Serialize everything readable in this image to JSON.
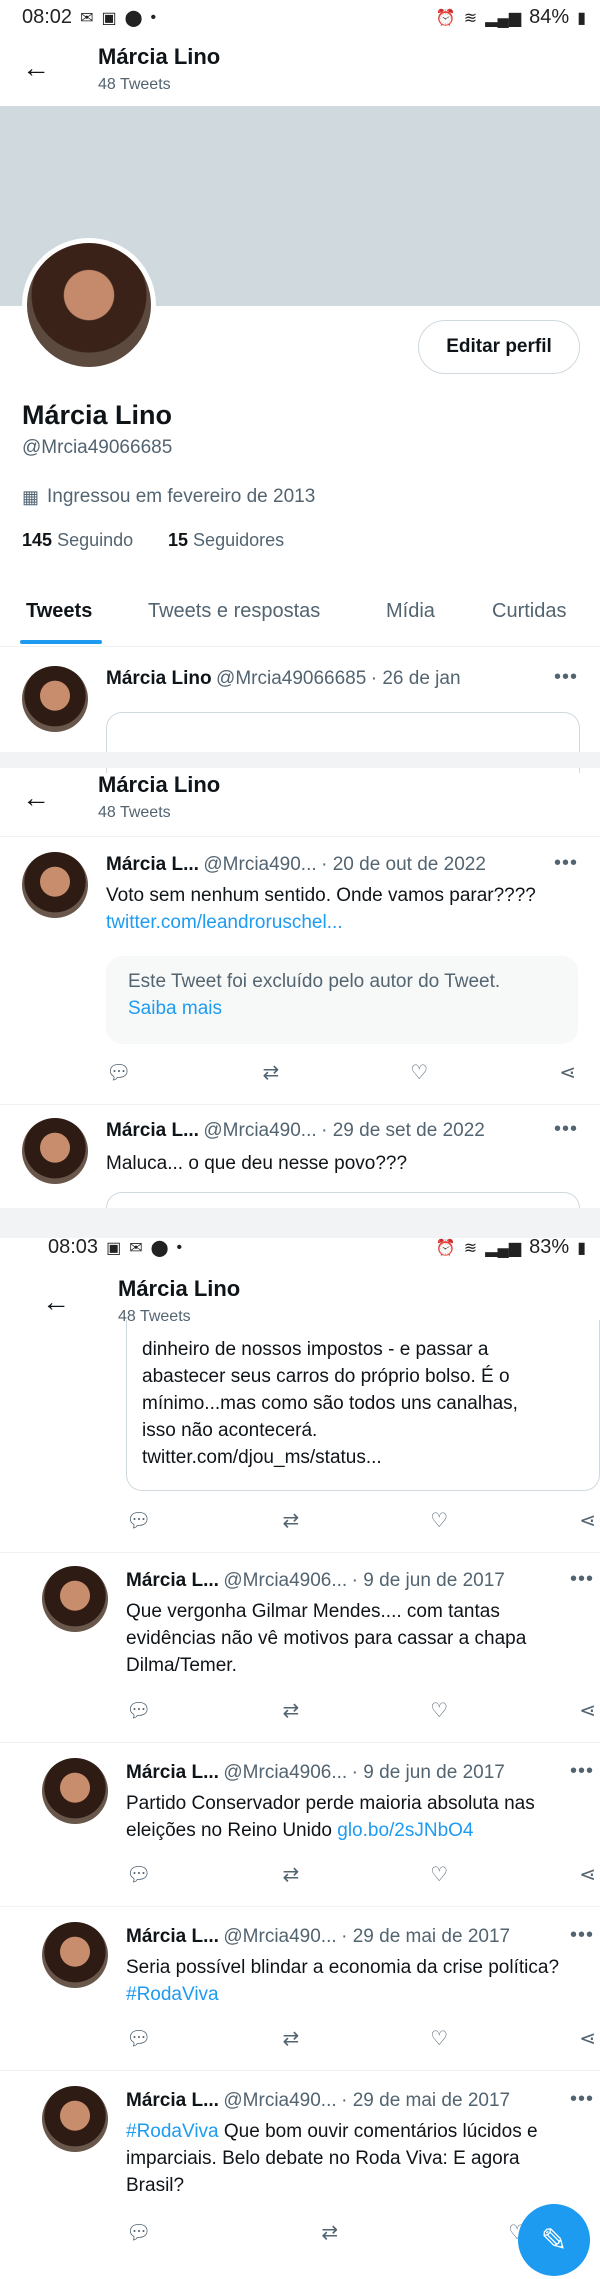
{
  "screens": [
    {
      "time": "08:02",
      "battery": "84%"
    },
    {
      "time": "08:03",
      "battery": "83%"
    }
  ],
  "header": {
    "title": "Márcia Lino",
    "subtitle": "48 Tweets"
  },
  "profile": {
    "name": "Márcia Lino",
    "handle": "@Mrcia49066685",
    "joined": "Ingressou em fevereiro de 2013",
    "following_count": "145",
    "following_label": "Seguindo",
    "followers_count": "15",
    "followers_label": "Seguidores",
    "edit_label": "Editar perfil"
  },
  "tabs": [
    "Tweets",
    "Tweets e respostas",
    "Mídia",
    "Curtidas"
  ],
  "tweets": [
    {
      "name": "Márcia Lino",
      "handle": "@Mrcia49066685",
      "date": "· 26 de jan",
      "text": ""
    },
    {
      "name": "Márcia L...",
      "handle": "@Mrcia490...",
      "date": "· 20 de out de 2022",
      "text": "Voto sem nenhum sentido. Onde vamos parar????",
      "link": "twitter.com/leandroruschel...",
      "deleted_text": "Este Tweet foi excluído pelo autor do Tweet.",
      "deleted_link": "Saiba mais"
    },
    {
      "name": "Márcia L...",
      "handle": "@Mrcia490...",
      "date": "· 29 de set de 2022",
      "text": "Maluca... o que deu nesse povo???"
    },
    {
      "quote_lines": [
        "dinheiro de nossos impostos - e passar a",
        "abastecer seus carros do próprio bolso. É o",
        "mínimo...mas como são todos uns canalhas,",
        "isso não acontecerá.",
        "twitter.com/djou_ms/status..."
      ]
    },
    {
      "name": "Márcia L...",
      "handle": "@Mrcia4906...",
      "date": "· 9 de jun de 2017",
      "text": "Que vergonha Gilmar Mendes.... com tantas evidências não vê motivos para cassar a chapa Dilma/Temer."
    },
    {
      "name": "Márcia L...",
      "handle": "@Mrcia4906...",
      "date": "· 9 de jun de 2017",
      "text": "Partido Conservador perde maioria absoluta nas eleições no Reino Unido",
      "link": "glo.bo/2sJNbO4"
    },
    {
      "name": "Márcia L...",
      "handle": "@Mrcia490...",
      "date": "· 29 de mai de 2017",
      "text": "Seria possível blindar a economia da crise política?",
      "hashtag": "#RodaViva"
    },
    {
      "name": "Márcia L...",
      "handle": "@Mrcia490...",
      "date": "· 29 de mai de 2017",
      "hashtag": "#RodaViva",
      "text": "Que bom ouvir comentários lúcidos e imparciais. Belo debate no Roda Viva: E agora Brasil?"
    }
  ],
  "icons": {
    "reply": "reply-icon",
    "retweet": "retweet-icon",
    "like": "like-icon",
    "share": "share-icon",
    "compose": "compose-icon"
  },
  "colors": {
    "accent": "#1d9bf0",
    "banner": "#cfd9de"
  }
}
